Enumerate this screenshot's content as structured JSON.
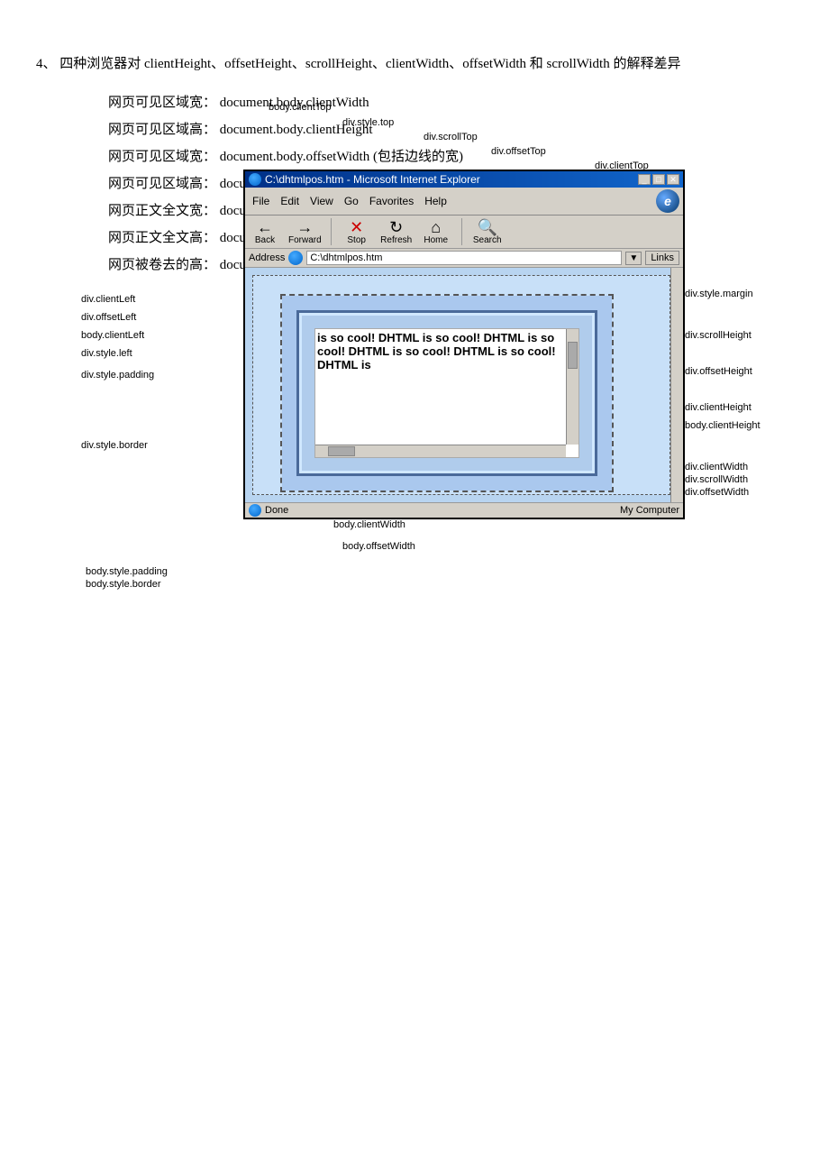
{
  "diagram": {
    "labels": {
      "bodyClientTop": "body.clientTop",
      "divStyleTop": "div.style.top",
      "divScrollTop": "div.scrollTop",
      "divOffsetTop": "div.offsetTop",
      "divClientTop": "div.clientTop",
      "divStyleMargin": "div.style.margin",
      "divClientLeft": "div.clientLeft",
      "divOffsetLeft": "div.offsetLeft",
      "bodyClientLeft": "body.clientLeft",
      "divStyleLeft": "div.style.left",
      "divStylePadding": "div.style.padding",
      "divStyleBorder": "div.style.border",
      "divScrollHeight": "div.scrollHeight",
      "divOffsetHeight": "div.offsetHeight",
      "divClientHeight": "div.clientHeight",
      "bodyClientHeight": "body.clientHeight",
      "divClientWidth": "div.clientWidth",
      "divScrollWidth": "div.scrollWidth",
      "divOffsetWidth": "div.offsetWidth",
      "bodyClientWidth": "body.clientWidth",
      "bodyOffsetWidth": "body.offsetWidth",
      "bodyStylePadding": "body.style.padding",
      "bodyStyleBorder": "body.style.border"
    },
    "browser": {
      "title": "C:\\dhtmlpos.htm - Microsoft Internet Explorer",
      "menu": [
        "File",
        "Edit",
        "View",
        "Go",
        "Favorites",
        "Help"
      ],
      "toolbar": [
        {
          "label": "Back",
          "icon": "←"
        },
        {
          "label": "Forward",
          "icon": "→"
        },
        {
          "label": "Stop",
          "icon": "✕"
        },
        {
          "label": "Refresh",
          "icon": "↻"
        },
        {
          "label": "Home",
          "icon": "⌂"
        },
        {
          "label": "Search",
          "icon": "🔍"
        }
      ],
      "address_label": "Address",
      "address_value": "C:\\dhtmlpos.htm",
      "links_label": "Links",
      "content_text": "is so cool! DHTML is so cool! DHTML is so cool! DHTML is so cool! DHTML is so cool! DHTML is",
      "status_text": "Done",
      "status_right": "My Computer"
    }
  },
  "section": {
    "intro": "4、 四种浏览器对 clientHeight、offsetHeight、scrollHeight、clientWidth、offsetWidth 和 scrollWidth 的解释差异",
    "items": [
      {
        "label": "网页可见区域宽：",
        "value": "document.body.clientWidth"
      },
      {
        "label": "网页可见区域高：",
        "value": "document.body.clientHeight"
      },
      {
        "label": "网页可见区域宽：",
        "value": "document.body.offsetWidth (包括边线的宽)"
      },
      {
        "label": "网页可见区域高：",
        "value": "document.body.offsetHeight (包括边线的宽)"
      },
      {
        "label": "网页正文全文宽：",
        "value": "document.body.scrollWidth"
      },
      {
        "label": "网页正文全文高：",
        "value": "document.body.scrollHeight"
      },
      {
        "label": "网页被卷去的高：",
        "value": "document.body.scrollTop"
      }
    ]
  }
}
